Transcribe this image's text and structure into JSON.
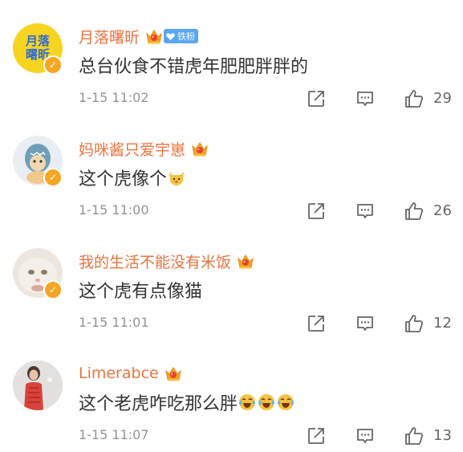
{
  "comments": [
    {
      "username": "月落曙昕",
      "fan_badge": "铁粉",
      "text": "总台伙食不错虎年肥肥胖胖的",
      "time": "1-15 11:02",
      "likes": "29",
      "avatar_text": [
        "月落",
        "曙昕"
      ]
    },
    {
      "username": "妈咪酱只爱宇崽",
      "text": "这个虎像个",
      "time": "1-15 11:00",
      "likes": "26",
      "emoji": "cat-face-emoji"
    },
    {
      "username": "我的生活不能没有米饭",
      "text": "这个虎有点像猫",
      "time": "1-15 11:01",
      "likes": "12"
    },
    {
      "username": "Limerabce",
      "text": "这个老虎咋吃那么胖",
      "time": "1-15 11:07",
      "likes": "13",
      "emoji": "laugh-cry-emoji"
    }
  ],
  "colors": {
    "username": "#eb7340",
    "verified_badge": "#f5a623",
    "fan_badge": "#5aa6f0",
    "body_text": "#333333",
    "meta_text": "#939393"
  },
  "icons": [
    "share-icon",
    "reply-icon",
    "like-icon",
    "crown-icon",
    "verified-icon"
  ]
}
